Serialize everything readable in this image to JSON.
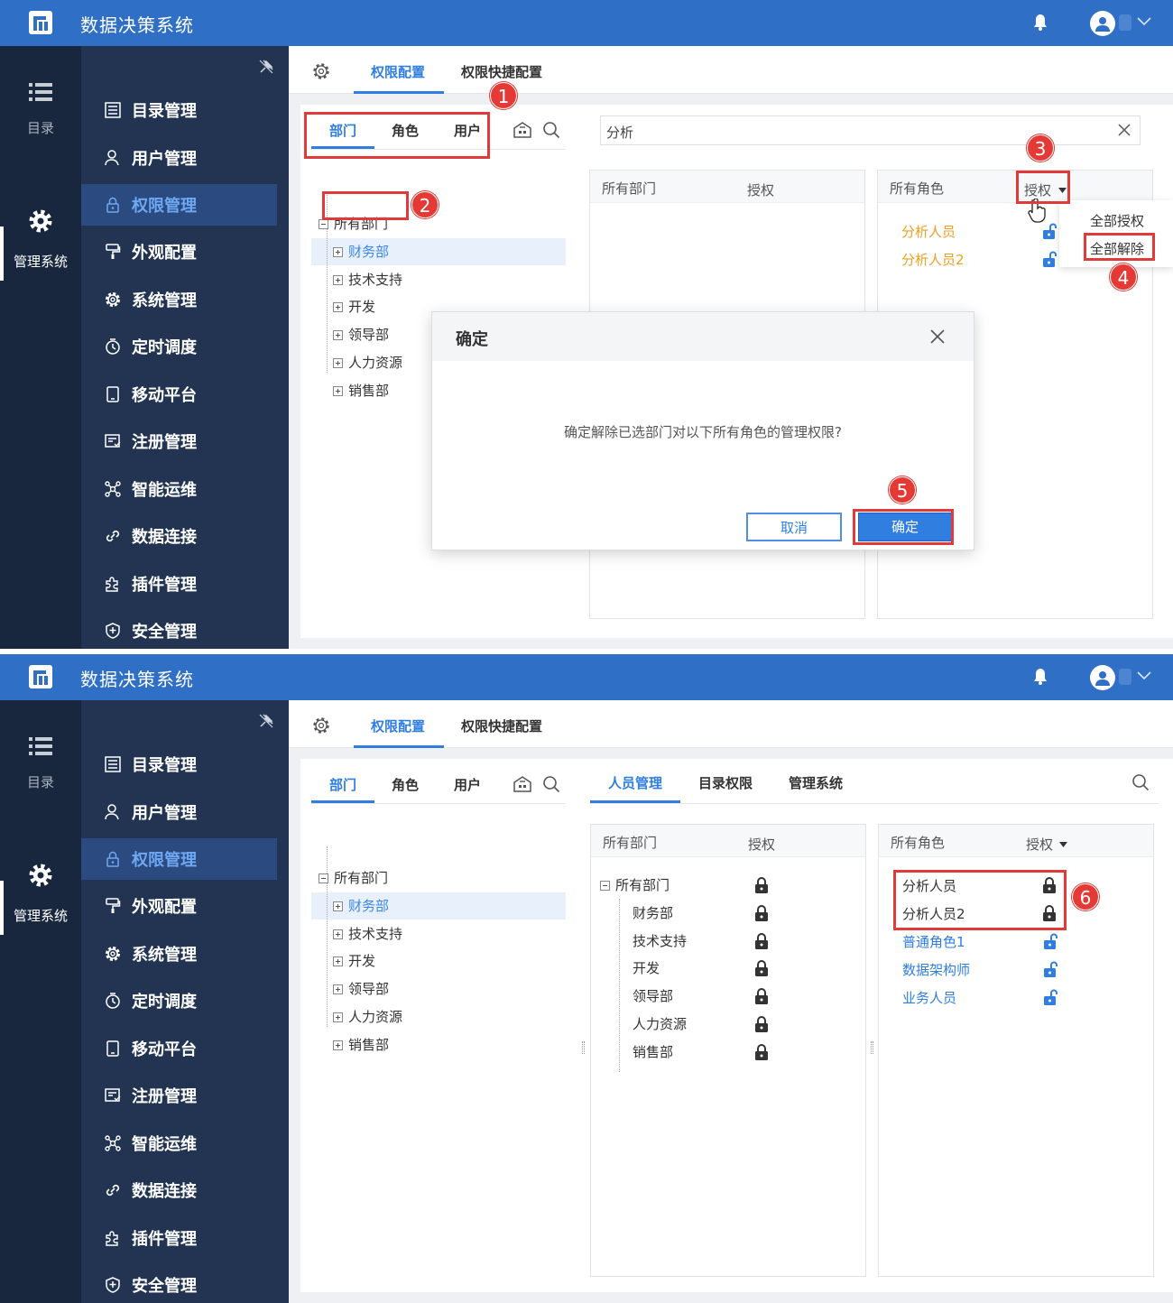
{
  "app": {
    "title": "数据决策系统"
  },
  "rail": {
    "catalog_label": "目录",
    "manager_label": "管理系统"
  },
  "menu": {
    "items": [
      {
        "label": "目录管理",
        "icon": "catalog-list-icon"
      },
      {
        "label": "用户管理",
        "icon": "user-icon"
      },
      {
        "label": "权限管理",
        "icon": "lock-icon"
      },
      {
        "label": "外观配置",
        "icon": "brush-icon"
      },
      {
        "label": "系统管理",
        "icon": "gear-icon"
      },
      {
        "label": "定时调度",
        "icon": "timer-icon"
      },
      {
        "label": "移动平台",
        "icon": "mobile-icon"
      },
      {
        "label": "注册管理",
        "icon": "register-icon"
      },
      {
        "label": "智能运维",
        "icon": "ops-icon"
      },
      {
        "label": "数据连接",
        "icon": "link-icon"
      },
      {
        "label": "插件管理",
        "icon": "plugin-icon"
      },
      {
        "label": "安全管理",
        "icon": "shield-icon"
      }
    ]
  },
  "tabs": {
    "config": "权限配置",
    "quick": "权限快捷配置"
  },
  "left_tabs": {
    "dept": "部门",
    "role": "角色",
    "user": "用户"
  },
  "tree": {
    "root": "所有部门",
    "children": [
      "财务部",
      "技术支持",
      "开发",
      "领导部",
      "人力资源",
      "销售部"
    ]
  },
  "shot1": {
    "search_value": "分析",
    "dept_header": "所有部门",
    "auth_header": "授权",
    "roles_header": "所有角色",
    "roles_auth": "授权",
    "roles": [
      "分析人员",
      "分析人员2"
    ],
    "dropdown": {
      "grant_all": "全部授权",
      "revoke_all": "全部解除"
    },
    "dialog": {
      "title": "确定",
      "message": "确定解除已选部门对以下所有角色的管理权限?",
      "cancel": "取消",
      "ok": "确定"
    },
    "badges": [
      "1",
      "2",
      "3",
      "4",
      "5"
    ]
  },
  "shot2": {
    "tabs": {
      "people": "人员管理",
      "catalog": "目录权限",
      "system": "管理系统"
    },
    "dept_header": "所有部门",
    "auth_header": "授权",
    "dept_tree": {
      "root": "所有部门",
      "children": [
        "财务部",
        "技术支持",
        "开发",
        "领导部",
        "人力资源",
        "销售部"
      ]
    },
    "roles_header": "所有角色",
    "roles_auth": "授权",
    "roles_locked": [
      "分析人员",
      "分析人员2"
    ],
    "roles_unlocked": [
      "普通角色1",
      "数据架构师",
      "业务人员"
    ],
    "badge": "6"
  },
  "colors": {
    "topbar": "#2f6fc6",
    "sidebar": "#223452",
    "rail": "#18273e",
    "accent": "#2f7ee0",
    "orange": "#f0a020",
    "highlight": "#e03a3a"
  }
}
